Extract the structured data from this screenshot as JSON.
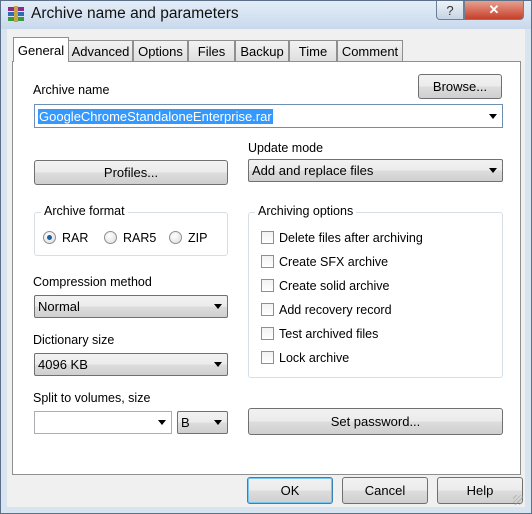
{
  "window": {
    "title": "Archive name and parameters",
    "help_glyph": "?",
    "close_glyph": "✕",
    "app_icon": "winrar-books-icon"
  },
  "tabs": [
    {
      "label": "General",
      "active": true
    },
    {
      "label": "Advanced",
      "active": false
    },
    {
      "label": "Options",
      "active": false
    },
    {
      "label": "Files",
      "active": false
    },
    {
      "label": "Backup",
      "active": false
    },
    {
      "label": "Time",
      "active": false
    },
    {
      "label": "Comment",
      "active": false
    }
  ],
  "general": {
    "archive_name_label": "Archive name",
    "archive_name_value": "GoogleChromeStandaloneEnterprise.rar",
    "browse_label": "Browse...",
    "profiles_label": "Profiles...",
    "update_mode_label": "Update mode",
    "update_mode_value": "Add and replace files",
    "archive_format": {
      "title": "Archive format",
      "options": [
        {
          "label": "RAR",
          "checked": true
        },
        {
          "label": "RAR5",
          "checked": false
        },
        {
          "label": "ZIP",
          "checked": false
        }
      ]
    },
    "compression_label": "Compression method",
    "compression_value": "Normal",
    "dictionary_label": "Dictionary size",
    "dictionary_value": "4096 KB",
    "split_label": "Split to volumes, size",
    "split_value": "",
    "split_unit": "B",
    "archiving_options": {
      "title": "Archiving options",
      "items": [
        {
          "label": "Delete files after archiving",
          "checked": false
        },
        {
          "label": "Create SFX archive",
          "checked": false
        },
        {
          "label": "Create solid archive",
          "checked": false
        },
        {
          "label": "Add recovery record",
          "checked": false
        },
        {
          "label": "Test archived files",
          "checked": false
        },
        {
          "label": "Lock archive",
          "checked": false
        }
      ]
    },
    "set_password_label": "Set password..."
  },
  "footer": {
    "ok_label": "OK",
    "cancel_label": "Cancel",
    "help_label": "Help"
  },
  "colors": {
    "selection": "#3399ff",
    "frame": "#d9e4f1",
    "close_button": "#c6402a"
  }
}
